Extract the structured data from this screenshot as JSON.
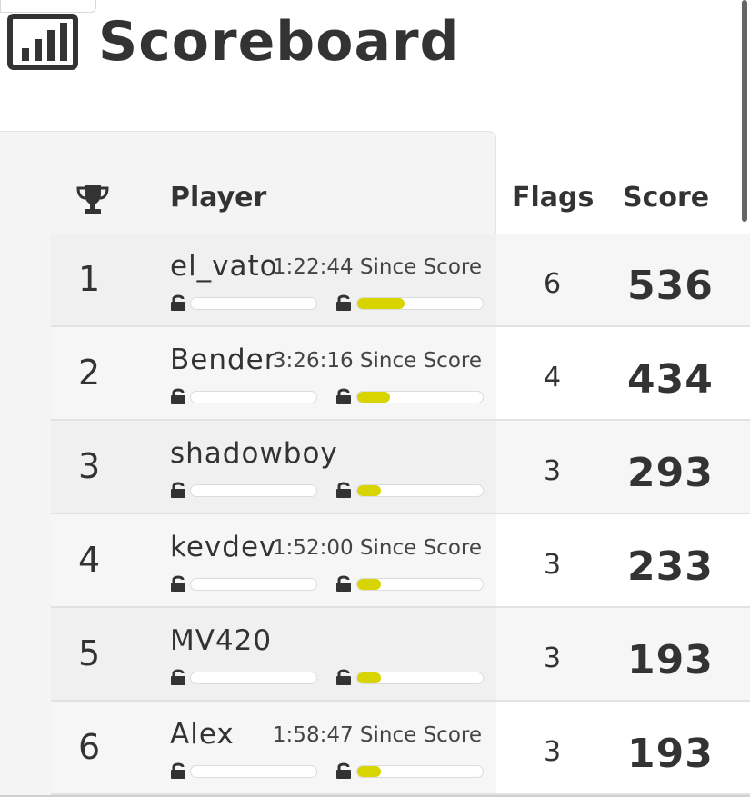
{
  "page": {
    "title": "Scoreboard",
    "title_icon": "bar-chart-icon"
  },
  "table": {
    "headers": {
      "rank_icon": "trophy-icon",
      "player": "Player",
      "flags": "Flags",
      "score": "Score"
    },
    "rows": [
      {
        "rank": "1",
        "player": "el_vato",
        "since": "1:22:44 Since Score",
        "flags": "6",
        "score": "536",
        "progress2": 0.38
      },
      {
        "rank": "2",
        "player": "Bender",
        "since": "3:26:16 Since Score",
        "flags": "4",
        "score": "434",
        "progress2": 0.26
      },
      {
        "rank": "3",
        "player": "shadowboy",
        "since": "",
        "flags": "3",
        "score": "293",
        "progress2": 0.19
      },
      {
        "rank": "4",
        "player": "kevdev",
        "since": "1:52:00 Since Score",
        "flags": "3",
        "score": "233",
        "progress2": 0.19
      },
      {
        "rank": "5",
        "player": "MV420",
        "since": "",
        "flags": "3",
        "score": "193",
        "progress2": 0.19
      },
      {
        "rank": "6",
        "player": "Alex",
        "since": "1:58:47 Since Score",
        "flags": "3",
        "score": "193",
        "progress2": 0.19
      }
    ]
  },
  "colors": {
    "progress_fill": "#d7d400",
    "text": "#333333"
  }
}
